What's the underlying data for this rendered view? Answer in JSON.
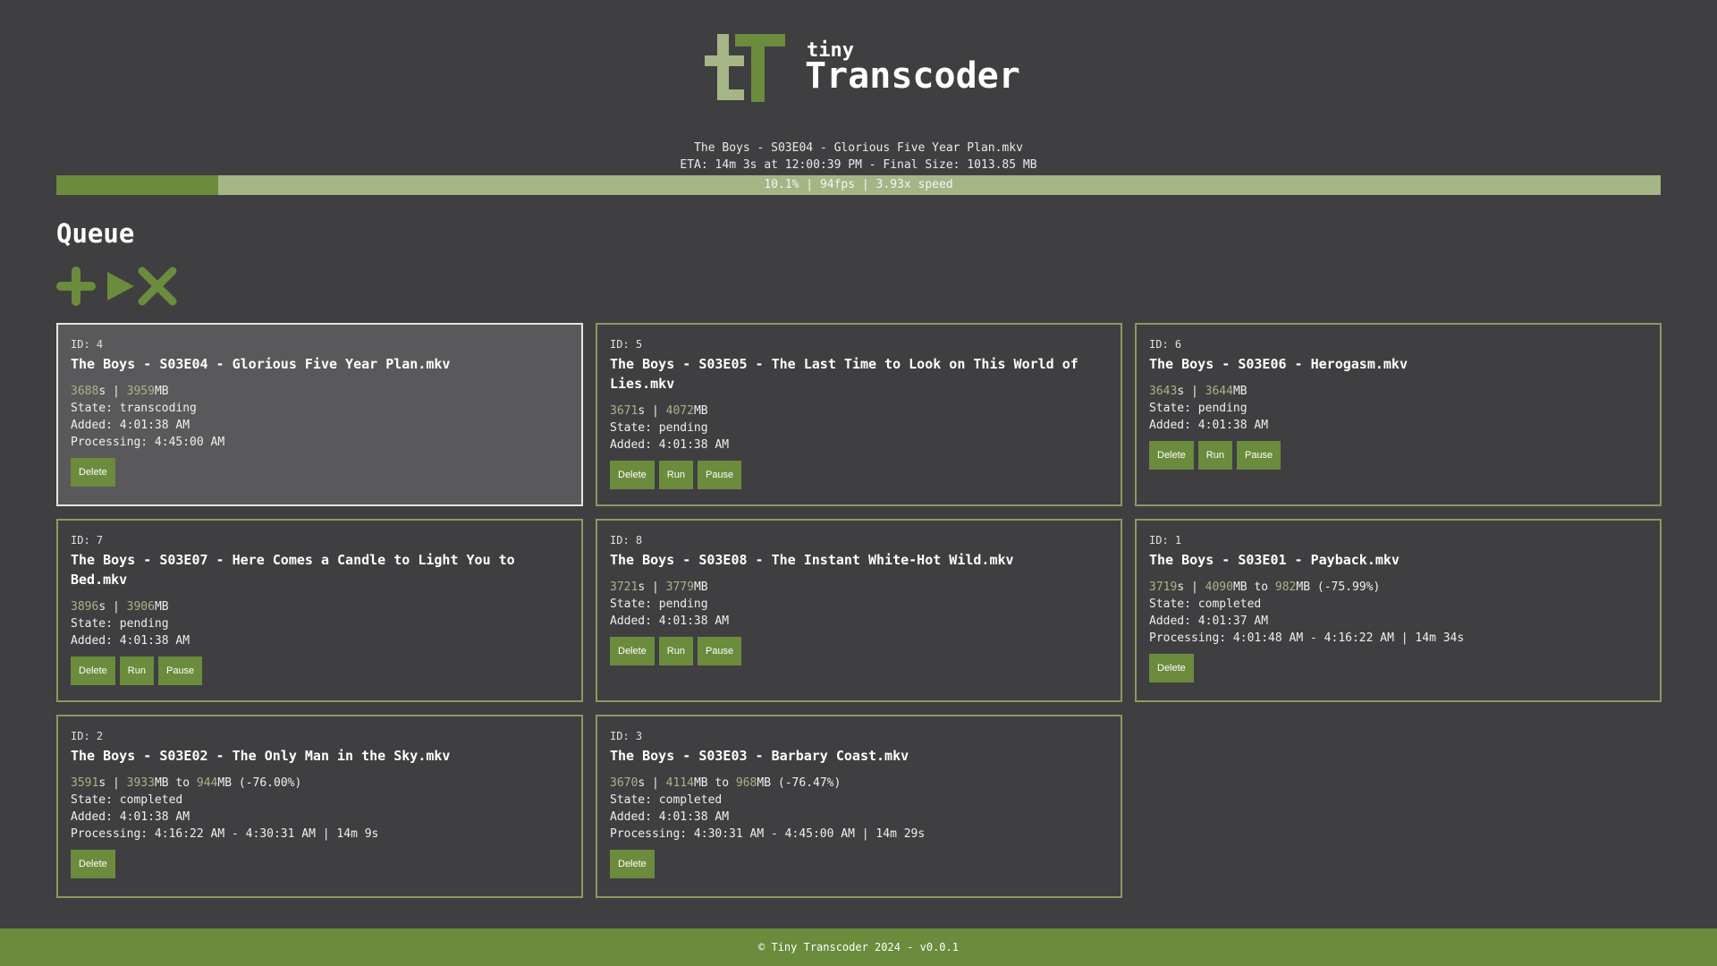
{
  "brand": {
    "small": "tiny",
    "big": "Transcoder",
    "accent": "#6b8b3d",
    "light_accent": "#a6b585"
  },
  "now_playing": {
    "file": "The Boys - S03E04 - Glorious Five Year Plan.mkv",
    "eta": "ETA: 14m 3s at 12:00:39 PM - Final Size: 1013.85 MB",
    "progress_text": "10.1% | 94fps | 3.93x speed",
    "progress_fraction": 0.101
  },
  "queue": {
    "title": "Queue",
    "actions": [
      {
        "icon": "plus-icon"
      },
      {
        "icon": "play-icon"
      },
      {
        "icon": "x-icon"
      }
    ]
  },
  "cards": [
    {
      "id": "ID: 4",
      "title": "The Boys - S03E04 - Glorious Five Year Plan.mkv",
      "seconds": "3688",
      "size": "3959",
      "size_to": "",
      "pct": "",
      "state": "State: transcoding",
      "added": "Added: 4:01:38 AM",
      "processing": "Processing: 4:45:00 AM",
      "active": true,
      "buttons": [
        "Delete"
      ]
    },
    {
      "id": "ID: 5",
      "title": "The Boys - S03E05 - The Last Time to Look on This World of Lies.mkv",
      "seconds": "3671",
      "size": "4072",
      "size_to": "",
      "pct": "",
      "state": "State: pending",
      "added": "Added: 4:01:38 AM",
      "processing": "",
      "active": false,
      "buttons": [
        "Delete",
        "Run",
        "Pause"
      ]
    },
    {
      "id": "ID: 6",
      "title": "The Boys - S03E06 - Herogasm.mkv",
      "seconds": "3643",
      "size": "3644",
      "size_to": "",
      "pct": "",
      "state": "State: pending",
      "added": "Added: 4:01:38 AM",
      "processing": "",
      "active": false,
      "buttons": [
        "Delete",
        "Run",
        "Pause"
      ]
    },
    {
      "id": "ID: 7",
      "title": "The Boys - S03E07 - Here Comes a Candle to Light You to Bed.mkv",
      "seconds": "3896",
      "size": "3906",
      "size_to": "",
      "pct": "",
      "state": "State: pending",
      "added": "Added: 4:01:38 AM",
      "processing": "",
      "active": false,
      "buttons": [
        "Delete",
        "Run",
        "Pause"
      ]
    },
    {
      "id": "ID: 8",
      "title": "The Boys - S03E08 - The Instant White-Hot Wild.mkv",
      "seconds": "3721",
      "size": "3779",
      "size_to": "",
      "pct": "",
      "state": "State: pending",
      "added": "Added: 4:01:38 AM",
      "processing": "",
      "active": false,
      "buttons": [
        "Delete",
        "Run",
        "Pause"
      ]
    },
    {
      "id": "ID: 1",
      "title": "The Boys - S03E01 - Payback.mkv",
      "seconds": "3719",
      "size": "4090",
      "size_to": "982",
      "pct": "(-75.99%)",
      "state": "State: completed",
      "added": "Added: 4:01:37 AM",
      "processing": "Processing: 4:01:48 AM - 4:16:22 AM | 14m 34s",
      "active": false,
      "buttons": [
        "Delete"
      ]
    },
    {
      "id": "ID: 2",
      "title": "The Boys - S03E02 - The Only Man in the Sky.mkv",
      "seconds": "3591",
      "size": "3933",
      "size_to": "944",
      "pct": "(-76.00%)",
      "state": "State: completed",
      "added": "Added: 4:01:38 AM",
      "processing": "Processing: 4:16:22 AM - 4:30:31 AM | 14m 9s",
      "active": false,
      "buttons": [
        "Delete"
      ]
    },
    {
      "id": "ID: 3",
      "title": "The Boys - S03E03 - Barbary Coast.mkv",
      "seconds": "3670",
      "size": "4114",
      "size_to": "968",
      "pct": "(-76.47%)",
      "state": "State: completed",
      "added": "Added: 4:01:38 AM",
      "processing": "Processing: 4:30:31 AM - 4:45:00 AM | 14m 29s",
      "active": false,
      "buttons": [
        "Delete"
      ]
    }
  ],
  "footer": {
    "text": "© Tiny Transcoder 2024 - v0.0.1"
  }
}
